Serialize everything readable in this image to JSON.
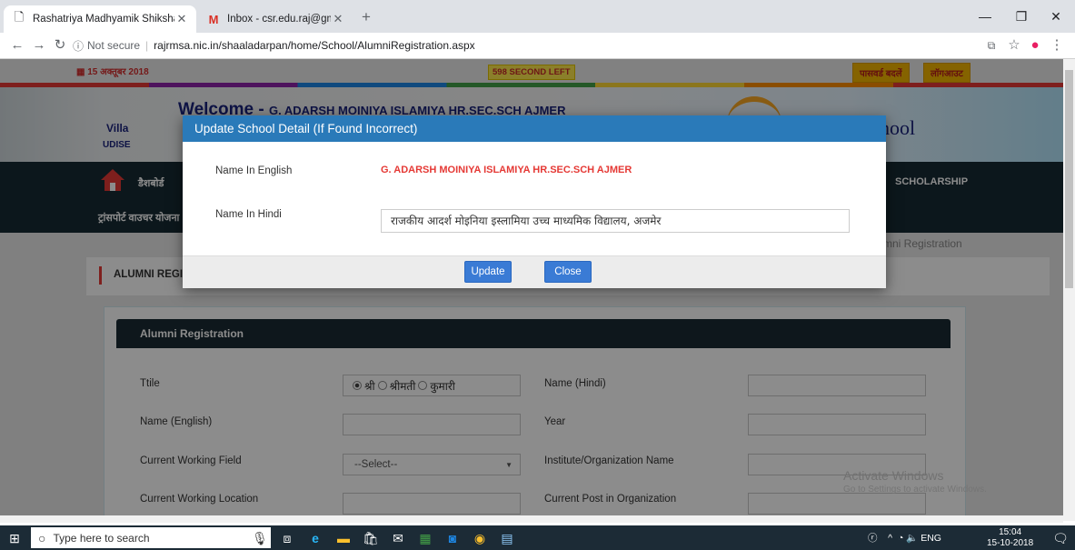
{
  "browser": {
    "tabs": [
      {
        "title": "Rashatriya Madhyamik Shiksha A",
        "icon": "page-icon",
        "active": true
      },
      {
        "title": "Inbox - csr.edu.raj@gmail.com - ",
        "icon": "gmail-icon",
        "active": false
      }
    ],
    "new_tab": "+",
    "security": "Not secure",
    "url": "rajrmsa.nic.in/shaaladarpan/home/School/AlumniRegistration.aspx"
  },
  "header": {
    "date": "15 अक्तूबर 2018",
    "timer": "598 SECOND LEFT",
    "change_password": "पासवर्ड बदलें",
    "logout": "लॉगआउट",
    "welcome_prefix": "Welcome - ",
    "welcome_school": "G. ADARSH MOINIYA ISLAMIYA HR.SEC.SCH AJMER",
    "village_label": "Villa",
    "udise_label": "UDISE",
    "logo_text": "hool"
  },
  "nav": {
    "dashboard": "डैशबोर्ड",
    "transport": "ट्रांसपोर्ट वाउचर योजना",
    "scholarship": "SCHOLARSHIP"
  },
  "breadcrumb": "mni Registration",
  "section_title": "ALUMNI REGI",
  "form": {
    "heading": "Alumni Registration",
    "title_label": "Ttile",
    "title_options": [
      "श्री",
      "श्रीमती",
      "कुमारी"
    ],
    "name_hindi_label": "Name (Hindi)",
    "name_english_label": "Name (English)",
    "year_label": "Year",
    "working_field_label": "Current Working Field",
    "working_field_value": "--Select--",
    "institute_label": "Institute/Organization Name",
    "working_location_label": "Current Working Location",
    "post_label": "Current Post in Organization"
  },
  "modal": {
    "title": "Update School Detail (If Found Incorrect)",
    "name_english_label": "Name In English",
    "name_english_value": "G. ADARSH MOINIYA ISLAMIYA HR.SEC.SCH AJMER",
    "name_hindi_label": "Name In Hindi",
    "name_hindi_value": "राजकीय आदर्श मोइनिया इस्लामिया उच्च माध्यमिक विद्यालय, अजमेर",
    "update_button": "Update",
    "close_button": "Close"
  },
  "watermark": {
    "line1": "Activate Windows",
    "line2": "Go to Settings to activate Windows."
  },
  "taskbar": {
    "search_placeholder": "Type here to search",
    "language": "ENG",
    "time": "15:04",
    "date": "15-10-2018"
  },
  "colors": {
    "modal_header": "#2a7ab9",
    "nav_bg": "#172a33",
    "error_red": "#e53935"
  }
}
